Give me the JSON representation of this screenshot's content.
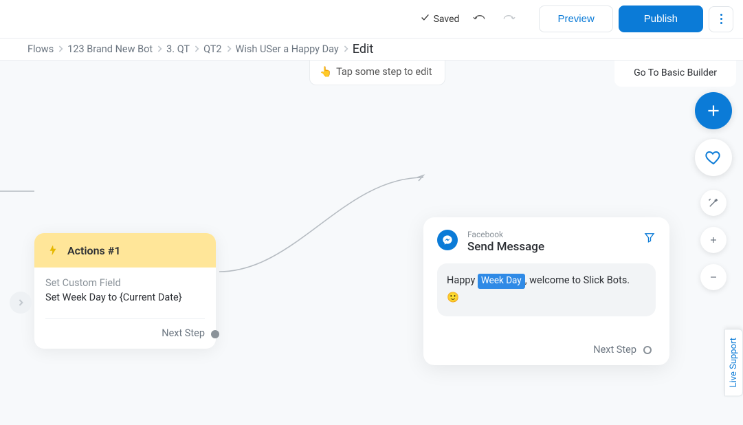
{
  "topbar": {
    "saved_label": "Saved",
    "preview_label": "Preview",
    "publish_label": "Publish"
  },
  "breadcrumbs": {
    "items": [
      "Flows",
      "123 Brand New Bot",
      "3. QT",
      "QT2",
      "Wish USer a Happy Day"
    ],
    "current": "Edit"
  },
  "hint": {
    "emoji": "👆",
    "text": "Tap some step to edit"
  },
  "goto_basic_label": "Go To Basic Builder",
  "actions_card": {
    "title": "Actions #1",
    "subheading": "Set Custom Field",
    "body": "Set Week Day to {Current Date}",
    "next_label": "Next Step"
  },
  "send_card": {
    "platform": "Facebook",
    "action_title": "Send Message",
    "message_prefix": "Happy ",
    "variable": "Week Day",
    "message_suffix": ", welcome to Slick Bots.",
    "emoji": "🙂",
    "next_label": "Next Step"
  },
  "live_support_label": "Live Support"
}
